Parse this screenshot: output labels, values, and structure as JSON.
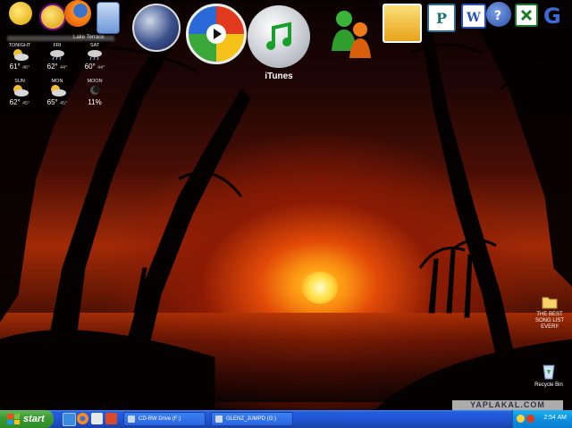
{
  "colors": {
    "accent_taskbar": "#245edb",
    "start_green": "#3c9a33",
    "tray_blue": "#0e8fde",
    "sky_top": "#0a0202",
    "sun": "#ffe24a"
  },
  "top_icons": [
    {
      "name": "yahoo-messenger-icon"
    },
    {
      "name": "yahoo-icon"
    },
    {
      "name": "firefox-icon"
    },
    {
      "name": "calculator-icon"
    },
    {
      "name": "network-globe-icon"
    },
    {
      "name": "windows-media-player-icon"
    },
    {
      "name": "itunes-icon",
      "label": "iTunes"
    },
    {
      "name": "msn-messenger-icon"
    },
    {
      "name": "outlook-icon"
    },
    {
      "name": "publisher-icon"
    },
    {
      "name": "word-icon"
    },
    {
      "name": "help-icon"
    },
    {
      "name": "excel-icon"
    },
    {
      "name": "google-icon"
    }
  ],
  "weather": {
    "location": "Lake Terrace",
    "days": [
      {
        "name": "TONIGHT",
        "hi": "61°",
        "lo": "46°"
      },
      {
        "name": "FRI",
        "hi": "62°",
        "lo": "44°"
      },
      {
        "name": "SAT",
        "hi": "60°",
        "lo": "44°"
      },
      {
        "name": "SUN",
        "hi": "62°",
        "lo": "45°"
      },
      {
        "name": "MON",
        "hi": "65°",
        "lo": "45°"
      },
      {
        "name": "MOON",
        "hi": "11%",
        "lo": ""
      }
    ]
  },
  "desktop_icons": {
    "best_song": "THE BEST SONG LIST EVER!!",
    "recycle_bin": "Recycle Bin"
  },
  "watermark": "YAPLAKAL.COM",
  "taskbar": {
    "start_label": "start",
    "tasks": [
      {
        "label": "CD-RW Drive (F:)"
      },
      {
        "label": "GLENZ_JUMPD (G:)"
      }
    ],
    "clock": "2:54 AM"
  }
}
